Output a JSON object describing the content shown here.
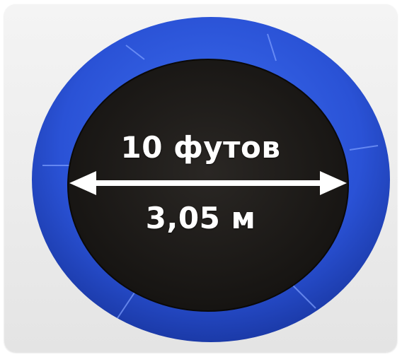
{
  "diameter": {
    "feet_label": "10 футов",
    "meters_label": "3,05 м"
  },
  "colors": {
    "pad_blue": "#2a52d6",
    "mat_dark": "#1c1a18",
    "background": "#ececec",
    "arrow": "#ffffff"
  }
}
